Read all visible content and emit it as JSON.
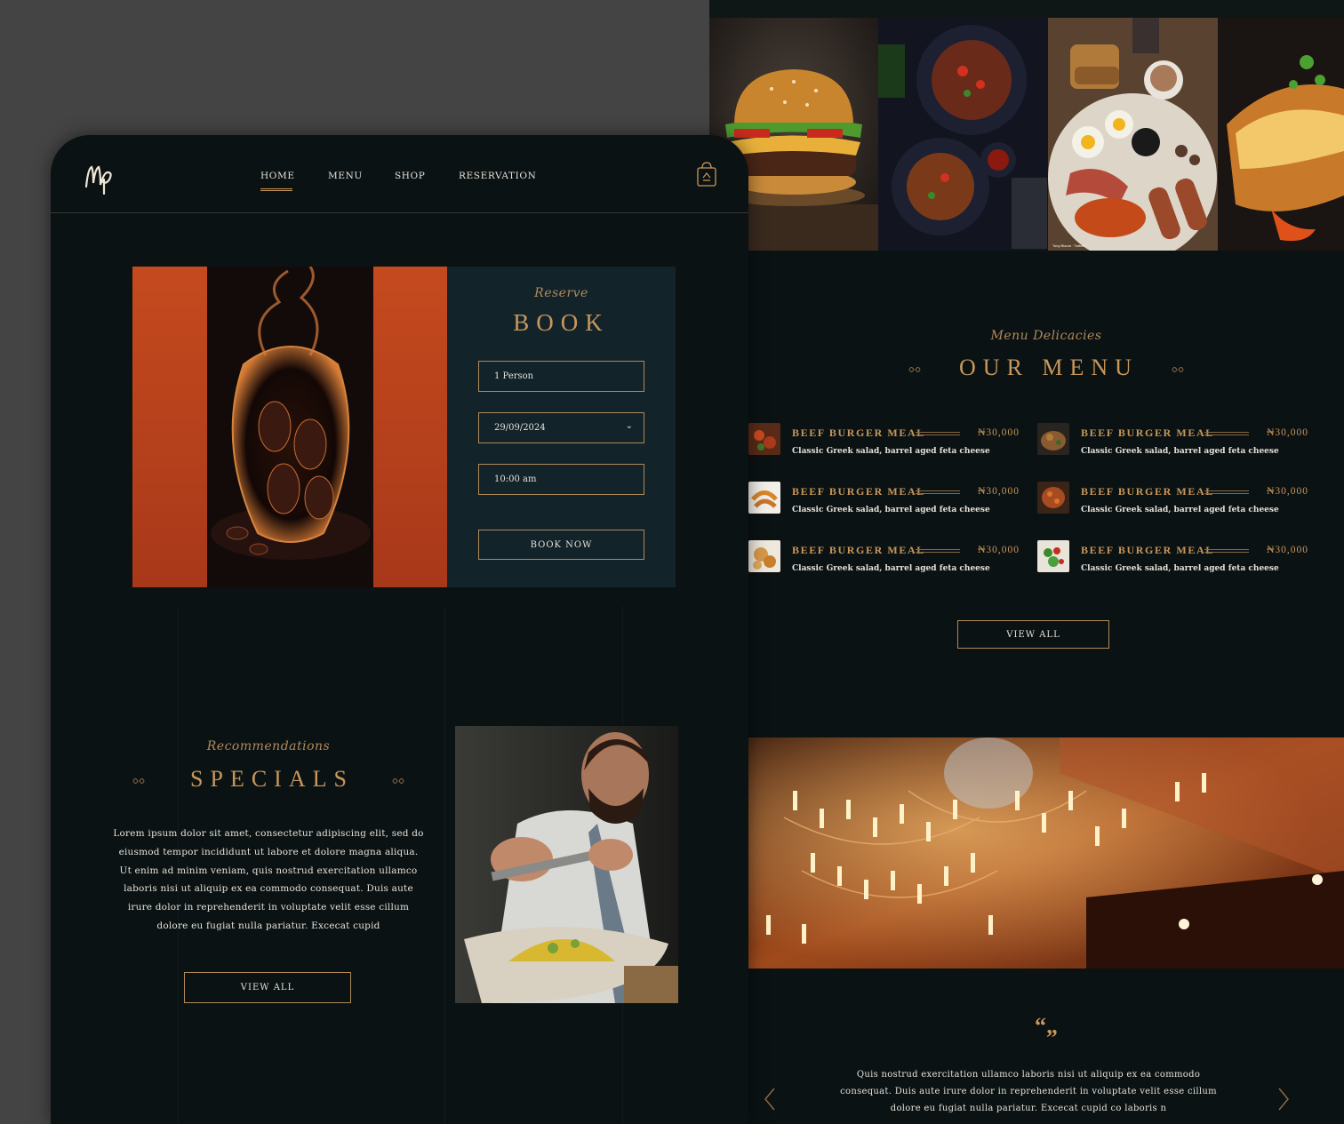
{
  "nav": {
    "items": [
      "HOME",
      "MENU",
      "SHOP",
      "RESERVATION"
    ],
    "active": "HOME"
  },
  "booking": {
    "script_title": "Reserve",
    "title": "BOOK",
    "persons": "1 Person",
    "date": "29/09/2024",
    "time": "10:00 am",
    "button": "BOOK NOW"
  },
  "specials": {
    "script_title": "Recommendations",
    "title": "SPECIALS",
    "body": "Lorem ipsum dolor sit amet, consectetur adipiscing elit, sed do eiusmod tempor incididunt ut labore et dolore magna aliqua. Ut enim ad minim veniam, quis nostrud exercitation ullamco laboris nisi ut aliquip ex ea commodo consequat. Duis aute irure dolor in reprehenderit in voluptate velit esse cillum dolore eu fugiat nulla pariatur. Excecat cupid",
    "button": "VIEW ALL"
  },
  "menu": {
    "script_title": "Menu Delicacies",
    "title": "OUR MENU",
    "items": [
      {
        "name": "BEEF BURGER MEAL",
        "price": "₦30,000",
        "desc": "Classic Greek salad, barrel aged feta cheese"
      },
      {
        "name": "BEEF BURGER MEAL",
        "price": "₦30,000",
        "desc": "Classic Greek salad, barrel aged feta cheese"
      },
      {
        "name": "BEEF BURGER MEAL",
        "price": "₦30,000",
        "desc": "Classic Greek salad, barrel aged feta cheese"
      },
      {
        "name": "BEEF BURGER MEAL",
        "price": "₦30,000",
        "desc": "Classic Greek salad, barrel aged feta cheese"
      },
      {
        "name": "BEEF BURGER MEAL",
        "price": "₦30,000",
        "desc": "Classic Greek salad, barrel aged feta cheese"
      },
      {
        "name": "BEEF BURGER MEAL",
        "price": "₦30,000",
        "desc": "Classic Greek salad, barrel aged feta cheese"
      }
    ],
    "button": "VIEW ALL"
  },
  "testimonial": {
    "quote_mark": "“„",
    "text": "Quis nostrud exercitation ullamco laboris nisi ut aliquip ex ea commodo consequat. Duis aute irure dolor in reprehenderit in voluptate velit esse cillum dolore eu fugiat nulla pariatur. Excecat cupid co laboris n"
  },
  "colors": {
    "background": "#0b1213",
    "panel": "#13232a",
    "gold": "#c8975a",
    "orange": "#c1481e",
    "outer": "#444444"
  },
  "icons": [
    "logo-monogram",
    "shopping-bag-icon",
    "ornament-icon",
    "chevron-down-icon",
    "arrow-left-icon",
    "arrow-right-icon"
  ]
}
